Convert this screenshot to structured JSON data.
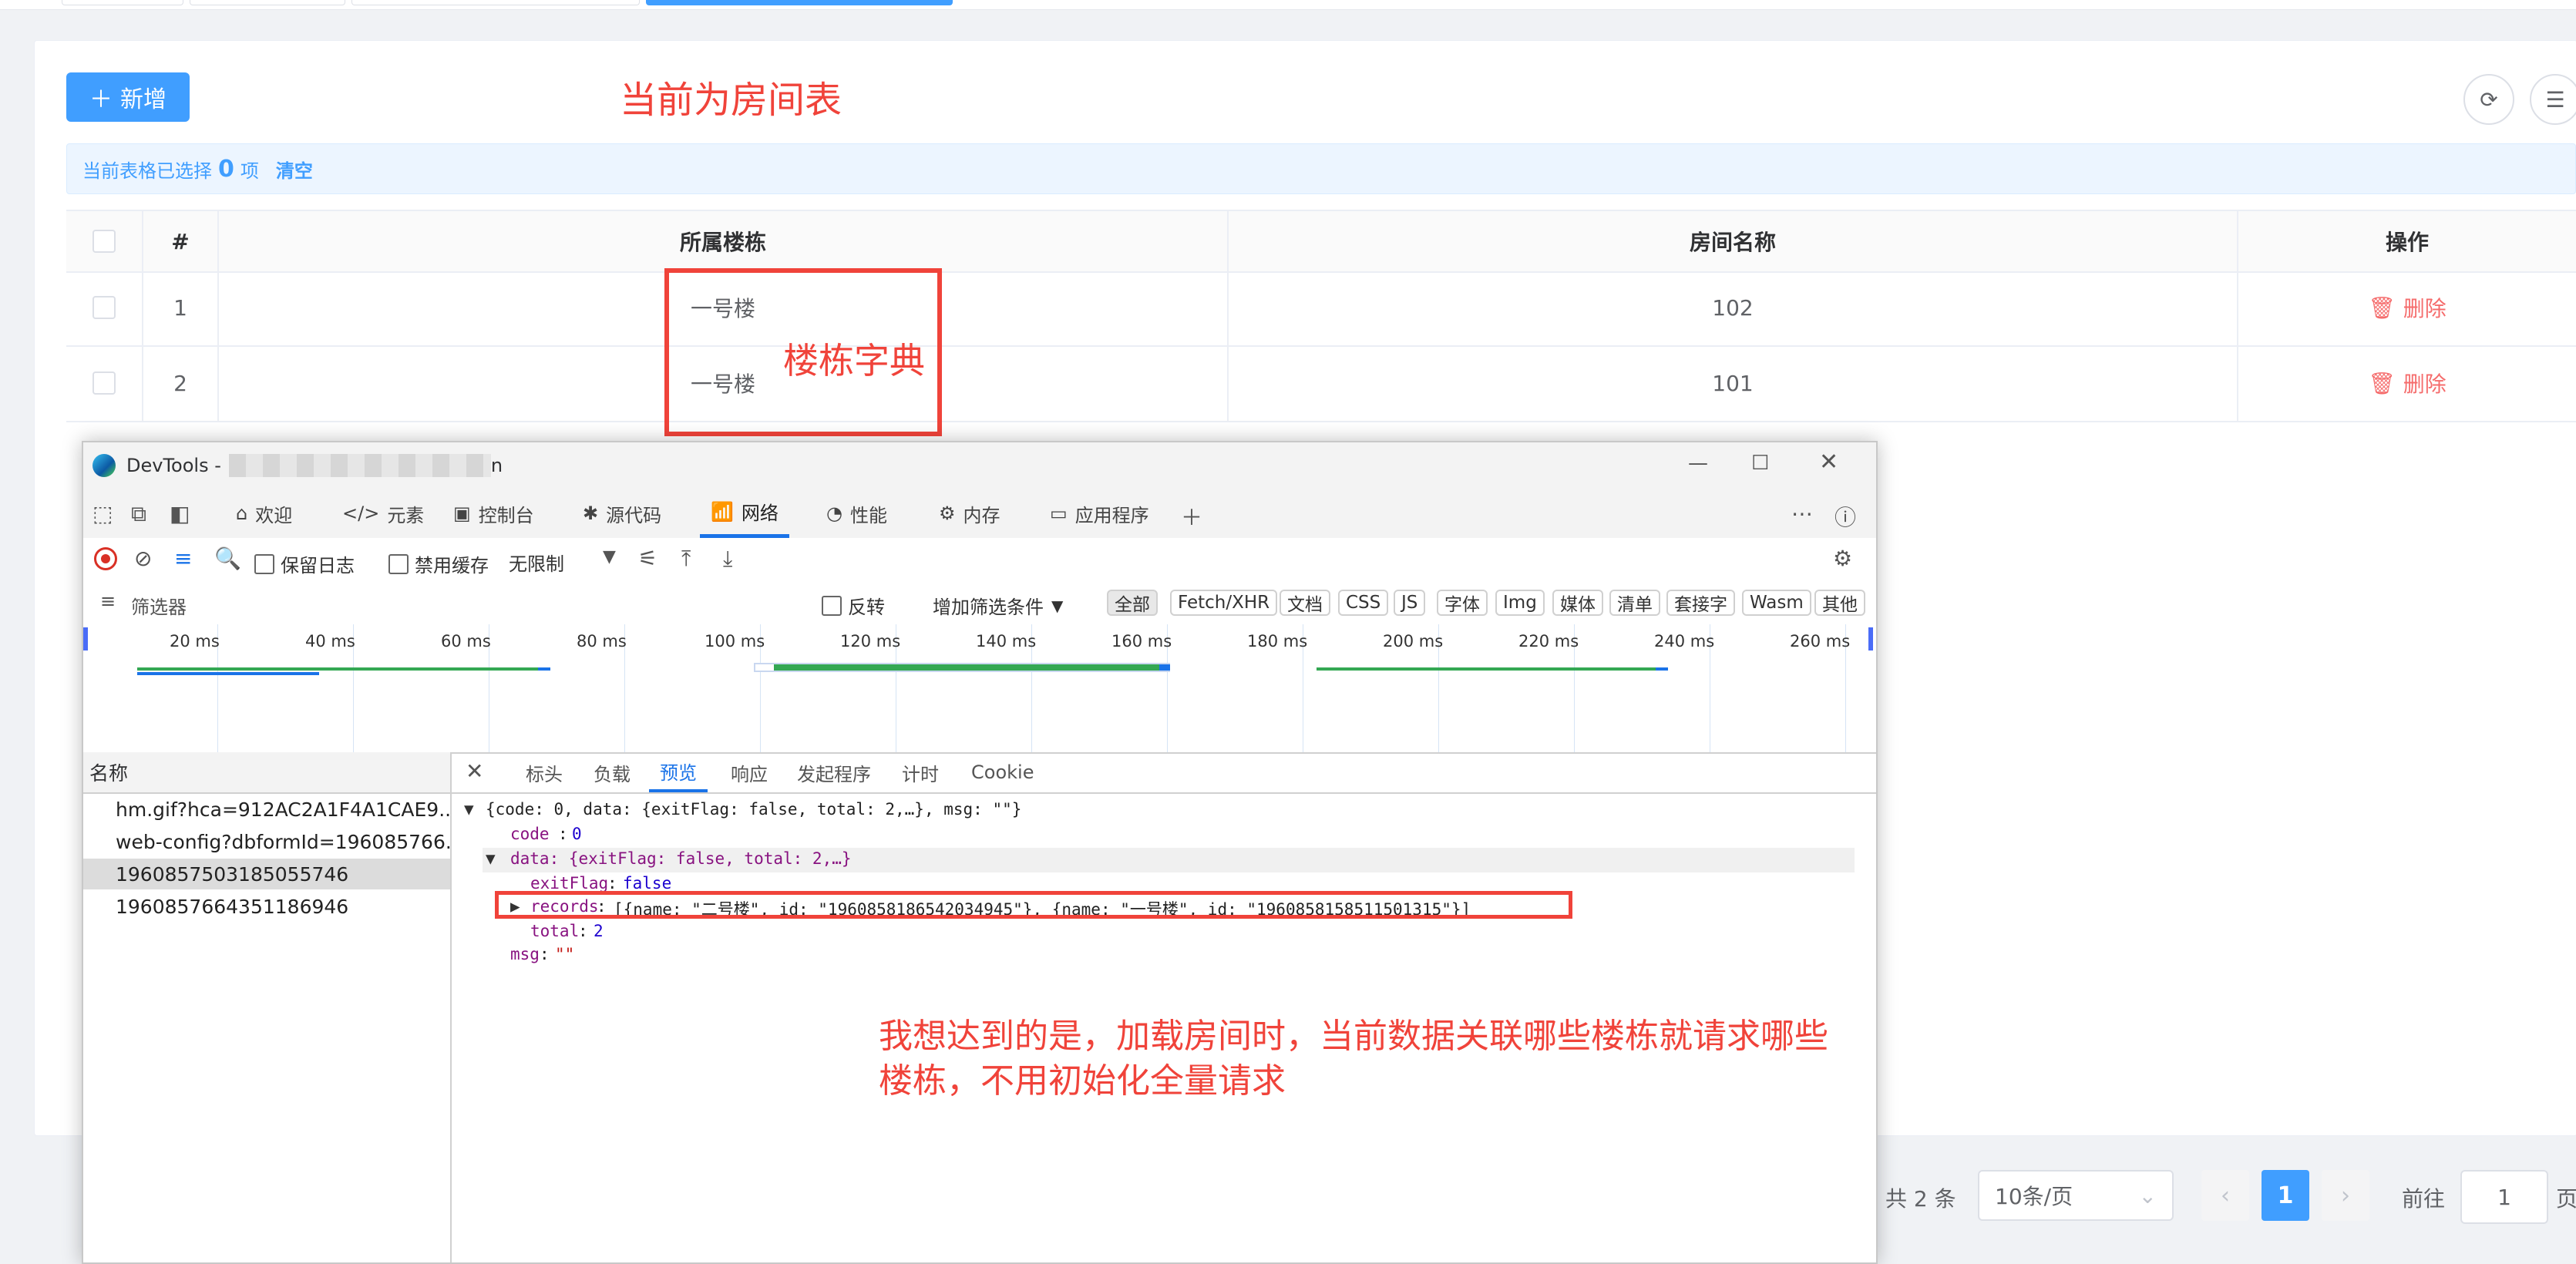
{
  "toolbar": {
    "add_label": "新增"
  },
  "annotations": {
    "room_table": "当前为房间表",
    "building_dict": "楼栋字典",
    "goal_line1": "我想达到的是，加载房间时，当前数据关联哪些楼栋就请求哪些",
    "goal_line2": "楼栋，不用初始化全量请求"
  },
  "selection": {
    "prefix": "当前表格已选择",
    "count": "0",
    "suffix": "项",
    "clear": "清空"
  },
  "table": {
    "headers": {
      "index": "#",
      "building": "所属楼栋",
      "room": "房间名称",
      "ops": "操作"
    },
    "rows": [
      {
        "index": "1",
        "building": "一号楼",
        "room": "102",
        "op": "删除"
      },
      {
        "index": "2",
        "building": "一号楼",
        "room": "101",
        "op": "删除"
      }
    ]
  },
  "pagination": {
    "total": "共 2 条",
    "page_size": "10条/页",
    "current": "1",
    "goto_label": "前往",
    "goto_value": "1",
    "page_suffix": "页"
  },
  "devtools": {
    "title_prefix": "DevTools -",
    "title_suffix": "n",
    "tabs": [
      "欢迎",
      "元素",
      "控制台",
      "源代码",
      "网络",
      "性能",
      "内存",
      "应用程序"
    ],
    "toolbar": {
      "preserve_log": "保留日志",
      "disable_cache": "禁用缓存",
      "throttle": "无限制"
    },
    "filter": {
      "placeholder": "筛选器",
      "invert": "反转",
      "more_filters": "增加筛选条件",
      "types": [
        "全部",
        "Fetch/XHR",
        "文档",
        "CSS",
        "JS",
        "字体",
        "Img",
        "媒体",
        "清单",
        "套接字",
        "Wasm",
        "其他"
      ]
    },
    "timeline_ticks": [
      "20 ms",
      "40 ms",
      "60 ms",
      "80 ms",
      "100 ms",
      "120 ms",
      "140 ms",
      "160 ms",
      "180 ms",
      "200 ms",
      "220 ms",
      "240 ms",
      "260 ms"
    ],
    "name_header": "名称",
    "requests": [
      "hm.gif?hca=912AC2A1F4A1CAE9...",
      "web-config?dbformId=196085766...",
      "1960857503185055746",
      "1960857664351186946"
    ],
    "detail_tabs": [
      "标头",
      "负载",
      "预览",
      "响应",
      "发起程序",
      "计时",
      "Cookie"
    ],
    "preview": {
      "root": "{code: 0, data: {exitFlag: false, total: 2,…}, msg: \"\"}",
      "code_key": "code",
      "code_val": "0",
      "data_line": "data: {exitFlag: false, total: 2,…}",
      "exit_key": "exitFlag",
      "exit_val": "false",
      "records_key": "records",
      "records_val": "[{name: \"二号楼\", id: \"1960858186542034945\"}, {name: \"一号楼\", id: \"1960858158511501315\"}]",
      "total_key": "total",
      "total_val": "2",
      "msg_key": "msg",
      "msg_val": "\"\""
    }
  },
  "colors": {
    "primary": "#409eff",
    "danger": "#f56c6c",
    "annotation": "#f0433a"
  }
}
